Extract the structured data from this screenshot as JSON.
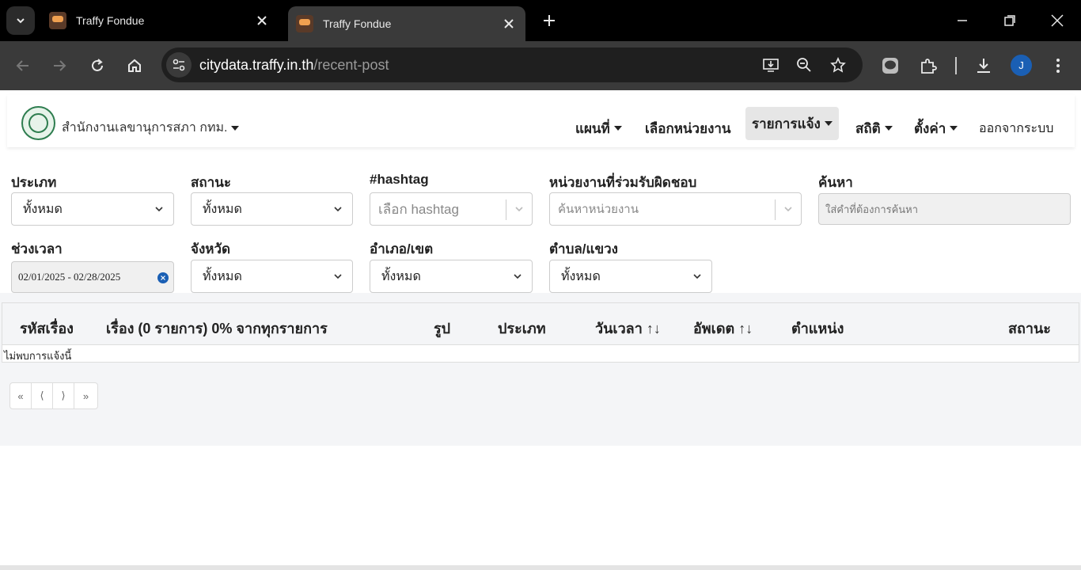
{
  "browser": {
    "tabs": [
      {
        "title": "Traffy Fondue"
      },
      {
        "title": "Traffy Fondue"
      }
    ],
    "url_host": "citydata.traffy.in.th",
    "url_path": "/recent-post",
    "profile_initial": "J"
  },
  "navbar": {
    "org_name": "สำนักงานเลขานุการสภา กทม.",
    "menu": {
      "map": "แผนที่",
      "select_unit": "เลือกหน่วยงาน",
      "reports": "รายการแจ้ง",
      "stats": "สถิติ",
      "settings": "ตั้งค่า",
      "logout": "ออกจากระบบ"
    }
  },
  "filters": {
    "type": {
      "label": "ประเภท",
      "value": "ทั้งหมด"
    },
    "status": {
      "label": "สถานะ",
      "value": "ทั้งหมด"
    },
    "hashtag": {
      "label": "#hashtag",
      "placeholder": "เลือก hashtag"
    },
    "unit": {
      "label": "หน่วยงานที่ร่วมรับผิดชอบ",
      "placeholder": "ค้นหาหน่วยงาน"
    },
    "search": {
      "label": "ค้นหา",
      "placeholder": "ใส่คำที่ต้องการค้นหา"
    },
    "period": {
      "label": "ช่วงเวลา",
      "value": "02/01/2025 - 02/28/2025"
    },
    "province": {
      "label": "จังหวัด",
      "value": "ทั้งหมด"
    },
    "district": {
      "label": "อำเภอ/เขต",
      "value": "ทั้งหมด"
    },
    "subdistrict": {
      "label": "ตำบล/แขวง",
      "value": "ทั้งหมด"
    }
  },
  "table": {
    "headers": {
      "id": "รหัสเรื่อง",
      "subject": "เรื่อง (0 รายการ) 0% จากทุกรายการ",
      "photo": "รูป",
      "type": "ประเภท",
      "datetime": "วันเวลา",
      "updated": "อัพเดต",
      "location": "ตำแหน่ง",
      "status": "สถานะ"
    },
    "sort_icon": "↑↓",
    "empty_text": "ไม่พบการแจ้งนี้"
  },
  "pagination": {
    "first": "«",
    "prev": "⟨",
    "next": "⟩",
    "last": "»"
  }
}
